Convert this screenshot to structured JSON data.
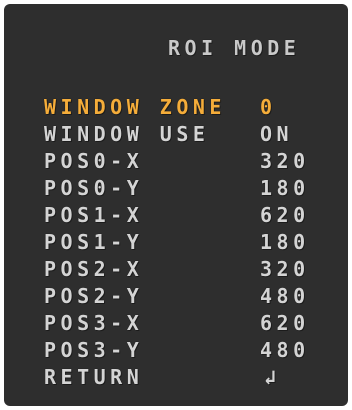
{
  "title": "ROI MODE",
  "colors": {
    "background": "#2e2e2e",
    "text": "#d4d4d4",
    "selected": "#f5ad3a"
  },
  "menu": {
    "items": [
      {
        "label": "WINDOW ZONE",
        "value": "0",
        "selected": true
      },
      {
        "label": "WINDOW USE",
        "value": "ON",
        "selected": false
      },
      {
        "label": "POS0-X",
        "value": "320",
        "selected": false
      },
      {
        "label": "POS0-Y",
        "value": "180",
        "selected": false
      },
      {
        "label": "POS1-X",
        "value": "620",
        "selected": false
      },
      {
        "label": "POS1-Y",
        "value": "180",
        "selected": false
      },
      {
        "label": "POS2-X",
        "value": "320",
        "selected": false
      },
      {
        "label": "POS2-Y",
        "value": "480",
        "selected": false
      },
      {
        "label": "POS3-X",
        "value": "620",
        "selected": false
      },
      {
        "label": "POS3-Y",
        "value": "480",
        "selected": false
      },
      {
        "label": "RETURN",
        "value": "↲",
        "icon": "enter-icon",
        "selected": false
      }
    ]
  }
}
